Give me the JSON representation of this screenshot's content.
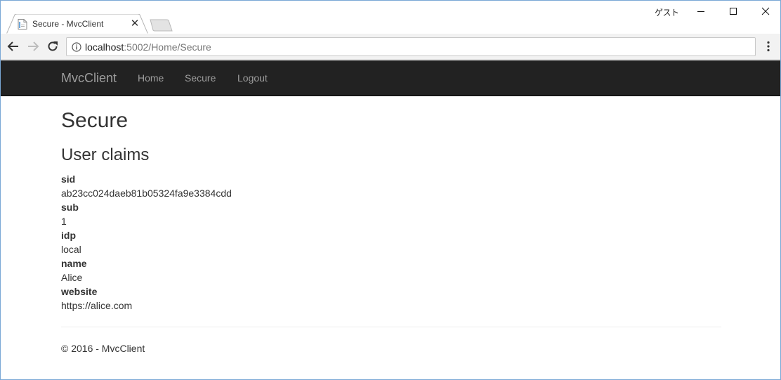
{
  "browser": {
    "tab_title": "Secure - MvcClient",
    "guest_label": "ゲスト",
    "url_host": "localhost",
    "url_path": ":5002/Home/Secure"
  },
  "navbar": {
    "brand": "MvcClient",
    "links": [
      "Home",
      "Secure",
      "Logout"
    ]
  },
  "page": {
    "title": "Secure",
    "section_title": "User claims",
    "claims": [
      {
        "type": "sid",
        "value": "ab23cc024daeb81b05324fa9e3384cdd"
      },
      {
        "type": "sub",
        "value": "1"
      },
      {
        "type": "idp",
        "value": "local"
      },
      {
        "type": "name",
        "value": "Alice"
      },
      {
        "type": "website",
        "value": "https://alice.com"
      }
    ]
  },
  "footer": {
    "text": "© 2016 - MvcClient"
  },
  "colors": {
    "navbar_bg": "#222222",
    "navbar_text": "#9d9d9d",
    "text": "#333333",
    "window_border": "#7aa7d6"
  }
}
